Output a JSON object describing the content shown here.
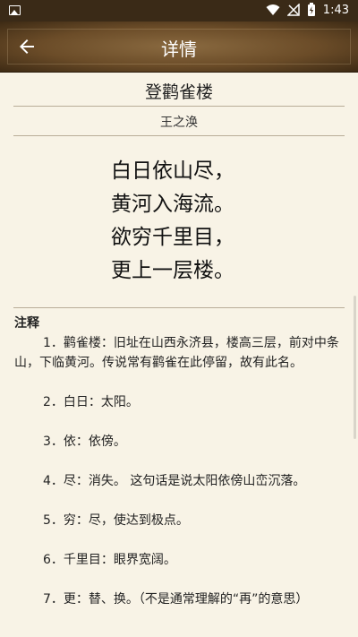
{
  "status_bar": {
    "time": "1:43"
  },
  "header": {
    "title": "详情"
  },
  "poem": {
    "title": "登鹳雀楼",
    "author": "王之涣",
    "lines": [
      "白日依山尽，",
      "黄河入海流。",
      "欲穷千里目，",
      "更上一层楼。"
    ]
  },
  "notes": {
    "heading": "注释",
    "items": [
      "1．鹳雀楼：旧址在山西永济县，楼高三层，前对中条山，下临黄河。传说常有鹳雀在此停留，故有此名。",
      "2．白日：太阳。",
      "3．依：依傍。",
      "4．尽：消失。 这句话是说太阳依傍山峦沉落。",
      "5．穷：尽，使达到极点。",
      "6．千里目：眼界宽阔。",
      "7．更：替、换。（不是通常理解的“再”的意思）"
    ]
  }
}
